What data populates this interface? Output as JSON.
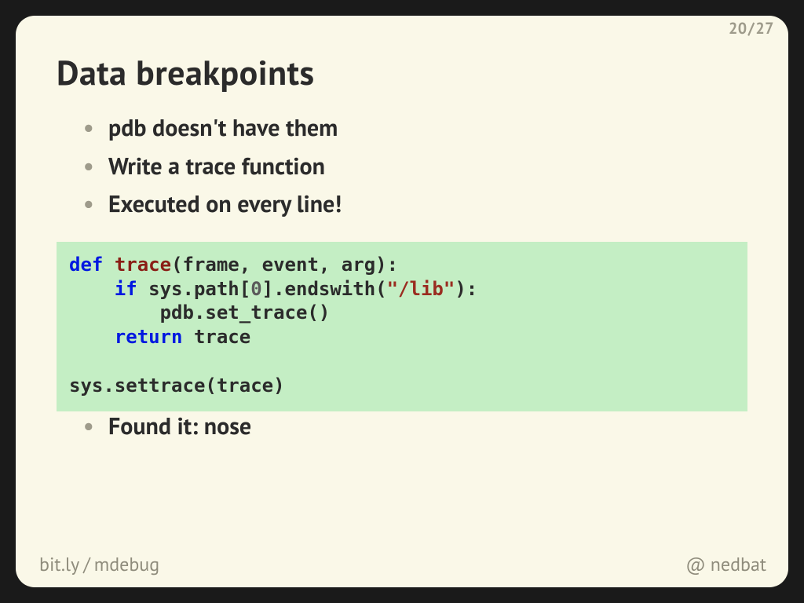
{
  "pager": {
    "current": "20",
    "total": "27"
  },
  "title": "Data breakpoints",
  "bullets_top": [
    "pdb doesn't have them",
    "Write a trace function",
    "Executed on every line!"
  ],
  "code": {
    "l1a": "def",
    "l1b": " ",
    "l1c": "trace",
    "l1d": "(frame, event, arg):",
    "l2a": "    ",
    "l2b": "if",
    "l2c": " sys.path[",
    "l2d": "0",
    "l2e": "].endswith(",
    "l2f": "\"/lib\"",
    "l2g": "):",
    "l3": "        pdb.set_trace()",
    "l4a": "    ",
    "l4b": "return",
    "l4c": " trace",
    "l5": "",
    "l6": "sys.settrace(trace)"
  },
  "bullets_bottom": [
    "Found it: nose"
  ],
  "footer": {
    "short_host": "bit.ly",
    "short_path": "mdebug",
    "at": "@",
    "handle": "nedbat"
  }
}
